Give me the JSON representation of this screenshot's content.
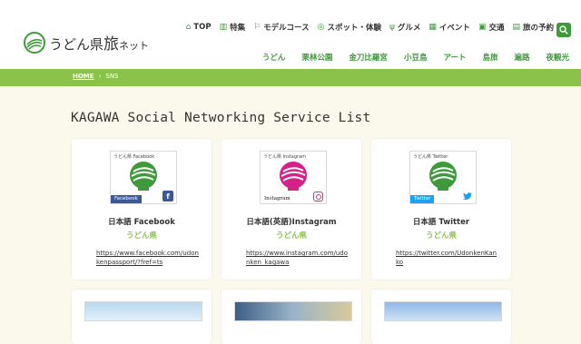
{
  "logo": {
    "text_main": "うどん県",
    "text_tabi": "旅",
    "text_net": "ネット"
  },
  "nav_primary": [
    {
      "icon": "home-icon",
      "glyph": "⌂",
      "label": "TOP"
    },
    {
      "icon": "book-icon",
      "glyph": "▥",
      "label": "特集"
    },
    {
      "icon": "flag-icon",
      "glyph": "⚐",
      "label": "モデルコース"
    },
    {
      "icon": "spot-icon",
      "glyph": "◎",
      "label": "スポット・体験"
    },
    {
      "icon": "fork-icon",
      "glyph": "ψ",
      "label": "グルメ"
    },
    {
      "icon": "calendar-icon",
      "glyph": "▦",
      "label": "イベント"
    },
    {
      "icon": "train-icon",
      "glyph": "▣",
      "label": "交通"
    },
    {
      "icon": "booking-icon",
      "glyph": "▤",
      "label": "旅の予約"
    }
  ],
  "nav_secondary": [
    "うどん",
    "栗林公園",
    "金刀比羅宮",
    "小豆島",
    "アート",
    "島旅",
    "遍路",
    "夜観光"
  ],
  "breadcrumb": {
    "home": "HOME",
    "sep": "›",
    "current": "SNS"
  },
  "page_title": "KAGAWA Social Networking Service List",
  "cards": [
    {
      "image_label": "うどん県 Facebook",
      "image_tag": "Facebook",
      "name": "日本語 Facebook",
      "sub": "うどん県",
      "link": "https://www.facebook.com/udonkenpassport/?fref=ts",
      "tag_color": "#3b5998",
      "icon_glyph": "f",
      "bowl_color": "#3e9a3a"
    },
    {
      "image_label": "うどん県 Instagram",
      "image_tag": "Instagram",
      "name": "日本語(英語)Instagram",
      "sub": "うどん県",
      "link": "https://www.instagram.com/udonken_kagawa",
      "tag_color": "#c13584",
      "icon_glyph": "◎",
      "bowl_color": "#d6218a"
    },
    {
      "image_label": "うどん県 Twitter",
      "image_tag": "Twitter",
      "name": "日本語 Twitter",
      "sub": "うどん県",
      "link": "https://twitter.com/UdonkenKanko",
      "tag_color": "#1da1f2",
      "icon_glyph": "✦",
      "bowl_color": "#3e9a3a"
    }
  ],
  "colors": {
    "accent_green": "#3e9a3a",
    "bar_green": "#8bc34a",
    "background": "#fbf9ec"
  }
}
